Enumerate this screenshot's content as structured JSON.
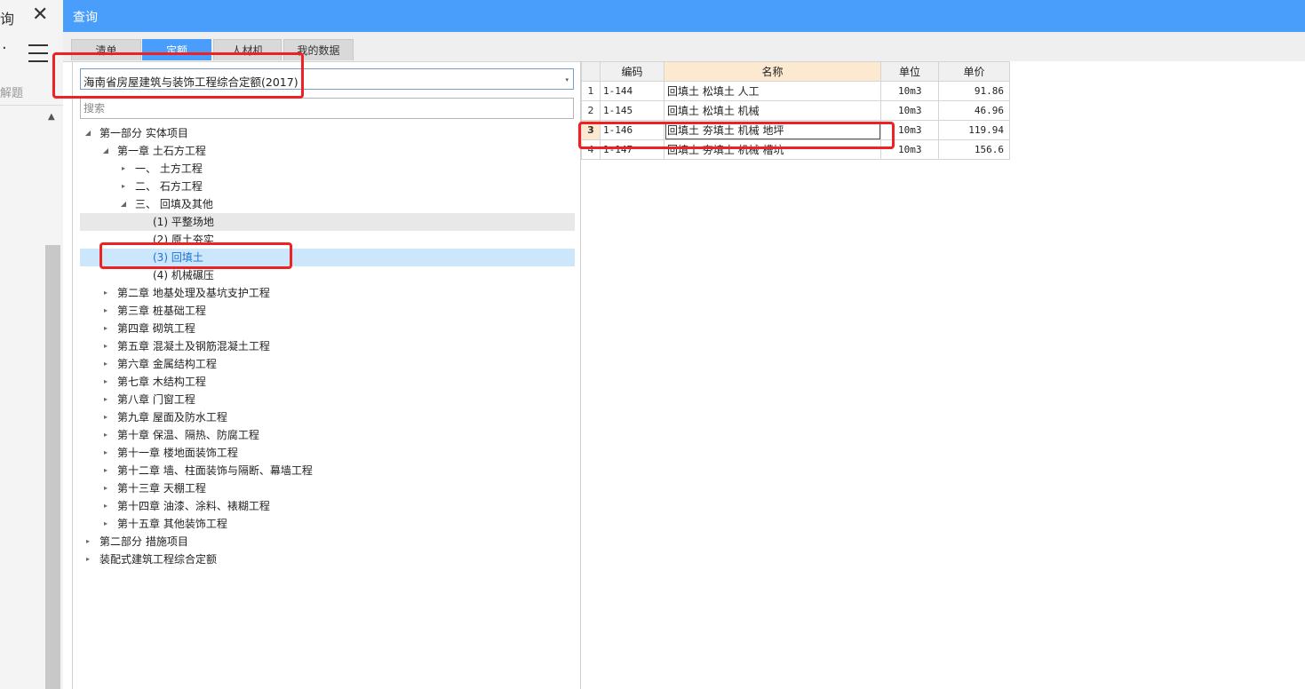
{
  "background": {
    "fragment_text": "询",
    "close_glyph": "✕",
    "dot_glyph": "·",
    "hint_text": "解题",
    "up_arrow": "▲"
  },
  "dialog": {
    "title": "查询",
    "accent_color": "#4a9efb",
    "highlight_color": "#ee2222",
    "tabs": [
      {
        "label": "清单",
        "active": false
      },
      {
        "label": "定额",
        "active": true
      },
      {
        "label": "人材机",
        "active": false
      },
      {
        "label": "我的数据",
        "active": false
      }
    ]
  },
  "left": {
    "quota_select": {
      "value": "海南省房屋建筑与装饰工程综合定额(2017)",
      "arrow": "▾"
    },
    "search": {
      "placeholder": "搜索",
      "value": ""
    },
    "tree": [
      {
        "label": "第一部分 实体项目",
        "expanded": true,
        "toggle": "◢"
      },
      {
        "label": "第一章 土石方工程",
        "expanded": true,
        "toggle": "◢"
      },
      {
        "label": "一、 土方工程",
        "expanded": false,
        "toggle": "▸"
      },
      {
        "label": "二、 石方工程",
        "expanded": false,
        "toggle": "▸"
      },
      {
        "label": "三、 回填及其他",
        "expanded": true,
        "toggle": "◢"
      },
      {
        "label": "(1) 平整场地",
        "toggle": ""
      },
      {
        "label": "(2) 原土夯实",
        "toggle": ""
      },
      {
        "label": "(3) 回填土",
        "toggle": "",
        "selected": true
      },
      {
        "label": "(4) 机械碾压",
        "toggle": ""
      },
      {
        "label": "第二章 地基处理及基坑支护工程",
        "toggle": "▸"
      },
      {
        "label": "第三章 桩基础工程",
        "toggle": "▸"
      },
      {
        "label": "第四章 砌筑工程",
        "toggle": "▸"
      },
      {
        "label": "第五章 混凝土及钢筋混凝土工程",
        "toggle": "▸"
      },
      {
        "label": "第六章 金属结构工程",
        "toggle": "▸"
      },
      {
        "label": "第七章 木结构工程",
        "toggle": "▸"
      },
      {
        "label": "第八章 门窗工程",
        "toggle": "▸"
      },
      {
        "label": "第九章 屋面及防水工程",
        "toggle": "▸"
      },
      {
        "label": "第十章 保温、隔热、防腐工程",
        "toggle": "▸"
      },
      {
        "label": "第十一章 楼地面装饰工程",
        "toggle": "▸"
      },
      {
        "label": "第十二章 墙、柱面装饰与隔断、幕墙工程",
        "toggle": "▸"
      },
      {
        "label": "第十三章 天棚工程",
        "toggle": "▸"
      },
      {
        "label": "第十四章 油漆、涂料、裱糊工程",
        "toggle": "▸"
      },
      {
        "label": "第十五章 其他装饰工程",
        "toggle": "▸"
      },
      {
        "label": "第二部分 措施项目",
        "toggle": "▸"
      },
      {
        "label": "装配式建筑工程综合定额",
        "toggle": "▸"
      }
    ]
  },
  "grid": {
    "columns": [
      "",
      "编码",
      "名称",
      "单位",
      "单价"
    ],
    "rows": [
      {
        "no": "1",
        "code": "1-144",
        "name": "回填土 松填土 人工",
        "unit": "10m3",
        "price": "91.86"
      },
      {
        "no": "2",
        "code": "1-145",
        "name": "回填土 松填土 机械",
        "unit": "10m3",
        "price": "46.96"
      },
      {
        "no": "3",
        "code": "1-146",
        "name": "回填土 夯填土 机械 地坪",
        "unit": "10m3",
        "price": "119.94",
        "current": true
      },
      {
        "no": "4",
        "code": "1-147",
        "name": "回填土 夯填土 机械 槽坑",
        "unit": "10m3",
        "price": "156.6"
      }
    ]
  }
}
